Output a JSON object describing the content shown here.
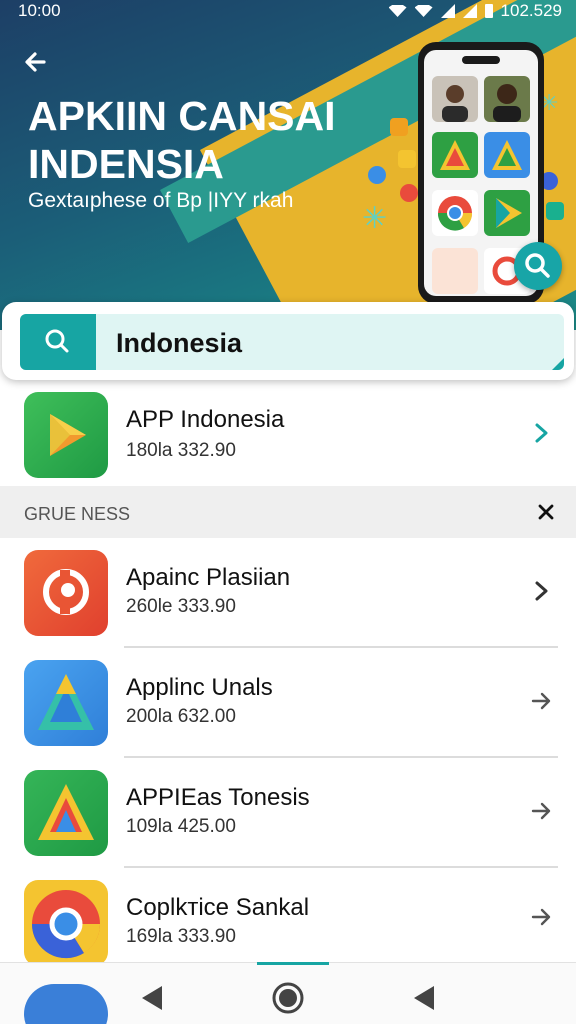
{
  "status": {
    "time": "10:00",
    "battery": "102.529"
  },
  "hero": {
    "title": "APKIIN CANSAI INDENSIA",
    "subtitle": "Gextaıphese of Bp |ΙΥΥ rkah"
  },
  "search": {
    "query": "Indonesia"
  },
  "featured": {
    "name": "APP Indonesia",
    "meta": "180la 332.90"
  },
  "section": {
    "label": "GRUE NESS"
  },
  "apps": [
    {
      "name": "Apainc Plasiian",
      "meta": "260le 333.90"
    },
    {
      "name": "Applinc Unals",
      "meta": "200la 632.00"
    },
    {
      "name": "APPIEas Tonesis",
      "meta": "109la 425.00"
    },
    {
      "name": "Coplkтice Sankal",
      "meta": "169la 333.90"
    }
  ],
  "icons": [
    "back-arrow-icon",
    "search-icon",
    "chevron-right-icon",
    "close-icon",
    "arrow-right-icon",
    "nav-back-icon",
    "nav-home-icon",
    "nav-recents-icon"
  ],
  "colors": {
    "accent": "#17a5a3",
    "hero": "#1d3f66",
    "stripe": "#e7b42c"
  }
}
